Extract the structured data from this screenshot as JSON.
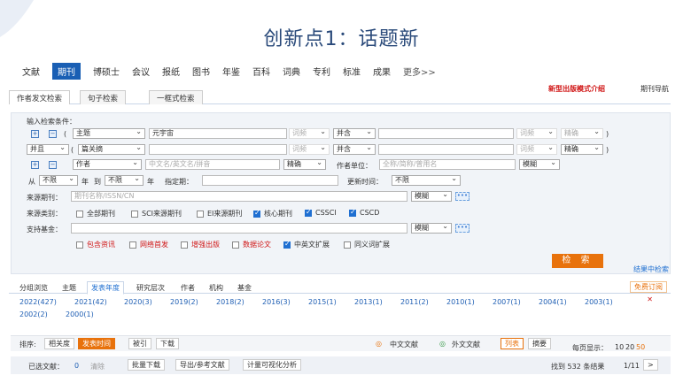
{
  "slide_title": "创新点1：话题新",
  "nav": [
    "文献",
    "期刊",
    "博硕士",
    "会议",
    "报纸",
    "图书",
    "年鉴",
    "百科",
    "词典",
    "专利",
    "标准",
    "成果",
    "更多>>"
  ],
  "subtabs": [
    "作者发文检索",
    "句子检索",
    "一框式检索"
  ],
  "promo": "新型出版模式介绍",
  "guide": "期刊导航",
  "panel": {
    "heading": "输入检索条件：",
    "row1": {
      "paren": "(",
      "field": "主题",
      "value": "元宇宙",
      "freq": "词频",
      "op": "并含",
      "freq2": "词频",
      "match": "精确",
      "close": ")"
    },
    "row2": {
      "logic": "并且",
      "paren": "(",
      "field": "篇关摘",
      "freq": "词频",
      "op": "并含",
      "freq2": "词频",
      "match": "精确",
      "close": ")"
    },
    "row3": {
      "field": "作者",
      "placeholder": "中文名/英文名/拼音",
      "match": "精确",
      "unit_label": "作者单位：",
      "unit_placeholder": "全称/简称/曾用名",
      "unit_match": "模糊"
    },
    "row4": {
      "from": "从",
      "from_val": "不限",
      "year": "年",
      "to": "到",
      "to_val": "不限",
      "year2": "年",
      "specified": "指定期：",
      "update_label": "更新时间：",
      "update_val": "不限"
    },
    "row5": {
      "label": "来源期刊：",
      "placeholder": "期刊名称/ISSN/CN",
      "match": "模糊",
      "dots": "•••"
    },
    "row6": {
      "label": "来源类别：",
      "options": [
        "全部期刊",
        "SCI来源期刊",
        "EI来源期刊",
        "核心期刊",
        "CSSCI",
        "CSCD"
      ]
    },
    "row7": {
      "label": "支持基金：",
      "match": "模糊",
      "dots": "•••"
    },
    "row8": {
      "options": [
        "包含资讯",
        "网络首发",
        "增强出版",
        "数据论文",
        "中英文扩展",
        "同义词扩展"
      ]
    },
    "search_button": "检 索",
    "within": "结果中检索"
  },
  "group": {
    "tabs": [
      "分组浏览",
      "主题",
      "发表年度",
      "研究层次",
      "作者",
      "机构",
      "基金"
    ],
    "free": "免费订阅"
  },
  "years": [
    "2022(427)",
    "2021(42)",
    "2020(3)",
    "2019(2)",
    "2018(2)",
    "2016(3)",
    "2015(1)",
    "2013(1)",
    "2011(2)",
    "2010(1)",
    "2007(1)",
    "2004(1)",
    "2003(1)",
    "2002(2)",
    "2000(1)"
  ],
  "sort": {
    "label": "排序:",
    "relevance": "相关度",
    "time": "发表时间",
    "cited": "被引",
    "downloads": "下载",
    "cn": "中文文献",
    "foreign": "外文文献",
    "list": "列表",
    "abstract": "摘要",
    "per_page": "每页显示：",
    "sizes": [
      "10",
      "20",
      "50"
    ]
  },
  "actions": {
    "selected": "已选文献：",
    "count": "0",
    "clear": "清除",
    "batch": "批量下载",
    "export": "导出/参考文献",
    "viz": "计量可视化分析",
    "found": "找到 532 条结果",
    "pages": "1/11",
    "next": ">"
  }
}
